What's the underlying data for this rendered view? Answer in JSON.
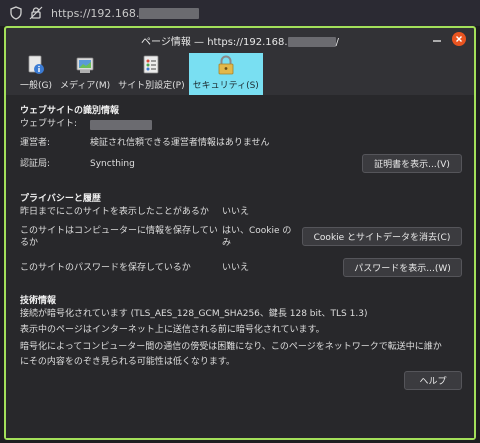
{
  "browser": {
    "url_prefix": "https://192.168."
  },
  "window": {
    "title_prefix": "ページ情報 — https://192.168.",
    "title_suffix": "/"
  },
  "tabs": [
    {
      "label": "一般(G)",
      "icon": "info-icon"
    },
    {
      "label": "メディア(M)",
      "icon": "media-icon"
    },
    {
      "label": "サイト別設定(P)",
      "icon": "permissions-icon"
    },
    {
      "label": "セキュリティ(S)",
      "icon": "lock-icon",
      "active": true
    }
  ],
  "identity": {
    "heading": "ウェブサイトの識別情報",
    "website_label": "ウェブサイト:",
    "owner_label": "運営者:",
    "owner_value": "検証され信頼できる運営者情報はありません",
    "cert_label": "認証局:",
    "cert_value": "Syncthing",
    "view_cert_button": "証明書を表示...(V)"
  },
  "privacy": {
    "heading": "プライバシーと履歴",
    "visited_q": "昨日までにこのサイトを表示したことがあるか",
    "visited_a": "いいえ",
    "cookies_q_line1": "このサイトはコンピューターに情報を保存してい",
    "cookies_q_line2": "るか",
    "cookies_a_line1": "はい、Cookie の",
    "cookies_a_line2": "み",
    "clear_cookies_button": "Cookie とサイトデータを消去(C)",
    "passwords_q": "このサイトのパスワードを保存しているか",
    "passwords_a": "いいえ",
    "view_passwords_button": "パスワードを表示...(W)"
  },
  "technical": {
    "heading": "技術情報",
    "line1": "接続が暗号化されています (TLS_AES_128_GCM_SHA256、鍵長 128 bit、TLS 1.3)",
    "line2": "表示中のページはインターネット上に送信される前に暗号化されています。",
    "line3": "暗号化によってコンピューター間の通信の傍受は困難になり、このページをネットワークで転送中に誰か",
    "line4": "にその内容をのぞき見られる可能性は低くなります。"
  },
  "help_button": "ヘルプ",
  "colors": {
    "accent_border": "#a3e05a",
    "active_tab": "#79dff2",
    "close_button": "#e95420"
  }
}
